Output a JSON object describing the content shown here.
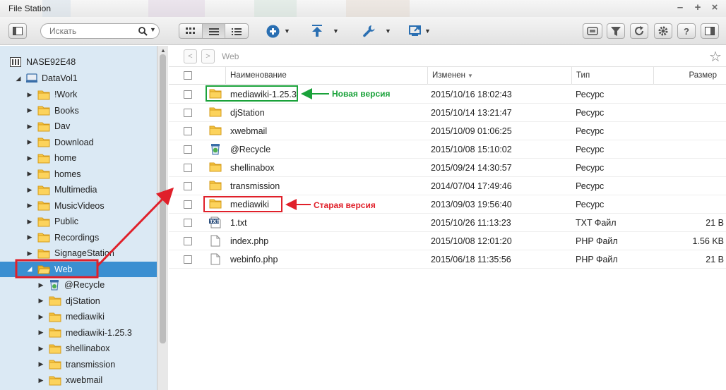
{
  "window": {
    "title": "File Station"
  },
  "toolbar": {
    "search_placeholder": "Искать"
  },
  "sidebar": {
    "nas": "NASE92E48",
    "volume": "DataVol1",
    "folders": [
      "!Work",
      "Books",
      "Dav",
      "Download",
      "home",
      "homes",
      "Multimedia",
      "MusicVideos",
      "Public",
      "Recordings",
      "SignageStation",
      "Web"
    ],
    "selected": "Web",
    "web_children": [
      "@Recycle",
      "djStation",
      "mediawiki",
      "mediawiki-1.25.3",
      "shellinabox",
      "transmission",
      "xwebmail"
    ]
  },
  "pathbar": {
    "back": "<",
    "forward": ">",
    "path": "Web"
  },
  "columns": {
    "name": "Наименование",
    "modified": "Изменен",
    "type": "Тип",
    "size": "Размер"
  },
  "files": [
    {
      "name": "mediawiki-1.25.3",
      "modified": "2015/10/16 18:02:43",
      "type": "Ресурс",
      "size": "",
      "icon": "folder-icon"
    },
    {
      "name": "djStation",
      "modified": "2015/10/14 13:21:47",
      "type": "Ресурс",
      "size": "",
      "icon": "folder-icon"
    },
    {
      "name": "xwebmail",
      "modified": "2015/10/09 01:06:25",
      "type": "Ресурс",
      "size": "",
      "icon": "folder-icon"
    },
    {
      "name": "@Recycle",
      "modified": "2015/10/08 15:10:02",
      "type": "Ресурс",
      "size": "",
      "icon": "recycle-folder-icon"
    },
    {
      "name": "shellinabox",
      "modified": "2015/09/24 14:30:57",
      "type": "Ресурс",
      "size": "",
      "icon": "folder-icon"
    },
    {
      "name": "transmission",
      "modified": "2014/07/04 17:49:46",
      "type": "Ресурс",
      "size": "",
      "icon": "folder-icon"
    },
    {
      "name": "mediawiki",
      "modified": "2013/09/03 19:56:40",
      "type": "Ресурс",
      "size": "",
      "icon": "folder-icon"
    },
    {
      "name": "1.txt",
      "modified": "2015/10/26 11:13:23",
      "type": "TXT Файл",
      "size": "21 B",
      "icon": "txt-file-icon"
    },
    {
      "name": "index.php",
      "modified": "2015/10/08 12:01:20",
      "type": "PHP Файл",
      "size": "1.56 KB",
      "icon": "file-icon"
    },
    {
      "name": "webinfo.php",
      "modified": "2015/06/18 11:35:56",
      "type": "PHP Файл",
      "size": "21 B",
      "icon": "file-icon"
    }
  ],
  "annotations": {
    "new_version": "Новая версия",
    "old_version": "Старая версия",
    "green": "#1aa23a",
    "red": "#e0202a"
  }
}
